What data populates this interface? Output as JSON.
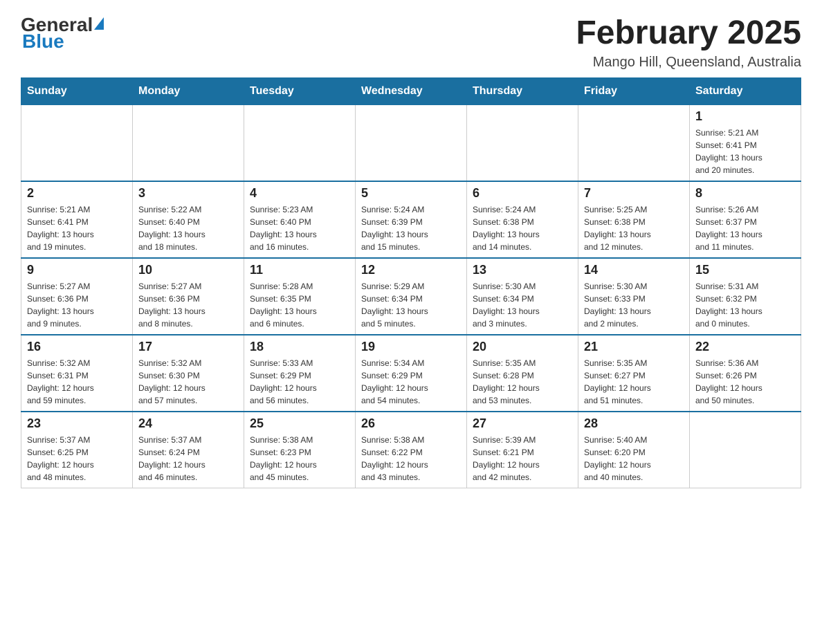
{
  "header": {
    "logo_general": "General",
    "logo_blue": "Blue",
    "title": "February 2025",
    "subtitle": "Mango Hill, Queensland, Australia"
  },
  "weekdays": [
    "Sunday",
    "Monday",
    "Tuesday",
    "Wednesday",
    "Thursday",
    "Friday",
    "Saturday"
  ],
  "weeks": [
    [
      {
        "day": "",
        "info": ""
      },
      {
        "day": "",
        "info": ""
      },
      {
        "day": "",
        "info": ""
      },
      {
        "day": "",
        "info": ""
      },
      {
        "day": "",
        "info": ""
      },
      {
        "day": "",
        "info": ""
      },
      {
        "day": "1",
        "info": "Sunrise: 5:21 AM\nSunset: 6:41 PM\nDaylight: 13 hours\nand 20 minutes."
      }
    ],
    [
      {
        "day": "2",
        "info": "Sunrise: 5:21 AM\nSunset: 6:41 PM\nDaylight: 13 hours\nand 19 minutes."
      },
      {
        "day": "3",
        "info": "Sunrise: 5:22 AM\nSunset: 6:40 PM\nDaylight: 13 hours\nand 18 minutes."
      },
      {
        "day": "4",
        "info": "Sunrise: 5:23 AM\nSunset: 6:40 PM\nDaylight: 13 hours\nand 16 minutes."
      },
      {
        "day": "5",
        "info": "Sunrise: 5:24 AM\nSunset: 6:39 PM\nDaylight: 13 hours\nand 15 minutes."
      },
      {
        "day": "6",
        "info": "Sunrise: 5:24 AM\nSunset: 6:38 PM\nDaylight: 13 hours\nand 14 minutes."
      },
      {
        "day": "7",
        "info": "Sunrise: 5:25 AM\nSunset: 6:38 PM\nDaylight: 13 hours\nand 12 minutes."
      },
      {
        "day": "8",
        "info": "Sunrise: 5:26 AM\nSunset: 6:37 PM\nDaylight: 13 hours\nand 11 minutes."
      }
    ],
    [
      {
        "day": "9",
        "info": "Sunrise: 5:27 AM\nSunset: 6:36 PM\nDaylight: 13 hours\nand 9 minutes."
      },
      {
        "day": "10",
        "info": "Sunrise: 5:27 AM\nSunset: 6:36 PM\nDaylight: 13 hours\nand 8 minutes."
      },
      {
        "day": "11",
        "info": "Sunrise: 5:28 AM\nSunset: 6:35 PM\nDaylight: 13 hours\nand 6 minutes."
      },
      {
        "day": "12",
        "info": "Sunrise: 5:29 AM\nSunset: 6:34 PM\nDaylight: 13 hours\nand 5 minutes."
      },
      {
        "day": "13",
        "info": "Sunrise: 5:30 AM\nSunset: 6:34 PM\nDaylight: 13 hours\nand 3 minutes."
      },
      {
        "day": "14",
        "info": "Sunrise: 5:30 AM\nSunset: 6:33 PM\nDaylight: 13 hours\nand 2 minutes."
      },
      {
        "day": "15",
        "info": "Sunrise: 5:31 AM\nSunset: 6:32 PM\nDaylight: 13 hours\nand 0 minutes."
      }
    ],
    [
      {
        "day": "16",
        "info": "Sunrise: 5:32 AM\nSunset: 6:31 PM\nDaylight: 12 hours\nand 59 minutes."
      },
      {
        "day": "17",
        "info": "Sunrise: 5:32 AM\nSunset: 6:30 PM\nDaylight: 12 hours\nand 57 minutes."
      },
      {
        "day": "18",
        "info": "Sunrise: 5:33 AM\nSunset: 6:29 PM\nDaylight: 12 hours\nand 56 minutes."
      },
      {
        "day": "19",
        "info": "Sunrise: 5:34 AM\nSunset: 6:29 PM\nDaylight: 12 hours\nand 54 minutes."
      },
      {
        "day": "20",
        "info": "Sunrise: 5:35 AM\nSunset: 6:28 PM\nDaylight: 12 hours\nand 53 minutes."
      },
      {
        "day": "21",
        "info": "Sunrise: 5:35 AM\nSunset: 6:27 PM\nDaylight: 12 hours\nand 51 minutes."
      },
      {
        "day": "22",
        "info": "Sunrise: 5:36 AM\nSunset: 6:26 PM\nDaylight: 12 hours\nand 50 minutes."
      }
    ],
    [
      {
        "day": "23",
        "info": "Sunrise: 5:37 AM\nSunset: 6:25 PM\nDaylight: 12 hours\nand 48 minutes."
      },
      {
        "day": "24",
        "info": "Sunrise: 5:37 AM\nSunset: 6:24 PM\nDaylight: 12 hours\nand 46 minutes."
      },
      {
        "day": "25",
        "info": "Sunrise: 5:38 AM\nSunset: 6:23 PM\nDaylight: 12 hours\nand 45 minutes."
      },
      {
        "day": "26",
        "info": "Sunrise: 5:38 AM\nSunset: 6:22 PM\nDaylight: 12 hours\nand 43 minutes."
      },
      {
        "day": "27",
        "info": "Sunrise: 5:39 AM\nSunset: 6:21 PM\nDaylight: 12 hours\nand 42 minutes."
      },
      {
        "day": "28",
        "info": "Sunrise: 5:40 AM\nSunset: 6:20 PM\nDaylight: 12 hours\nand 40 minutes."
      },
      {
        "day": "",
        "info": ""
      }
    ]
  ]
}
